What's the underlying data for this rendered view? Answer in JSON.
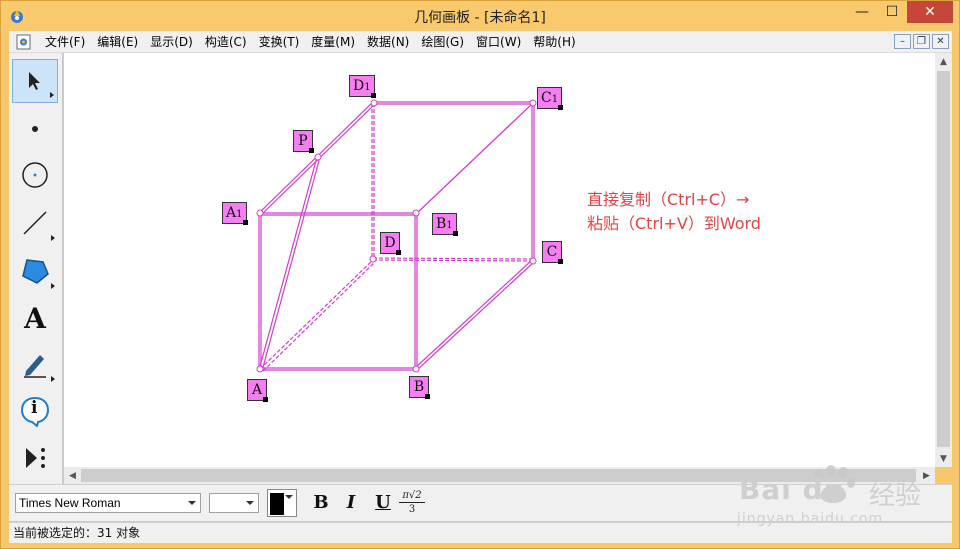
{
  "window": {
    "title": "几何画板 - [未命名1]",
    "minimize": "—",
    "maximize": "☐",
    "close": "✕"
  },
  "menu": {
    "items": [
      "文件(F)",
      "编辑(E)",
      "显示(D)",
      "构造(C)",
      "变换(T)",
      "度量(M)",
      "数据(N)",
      "绘图(G)",
      "窗口(W)",
      "帮助(H)"
    ],
    "mdi_minimize": "–",
    "mdi_restore": "❐",
    "mdi_close": "✕"
  },
  "toolbox": {
    "tools": [
      "select-arrow-tool",
      "point-tool",
      "compass-tool",
      "segment-tool",
      "polygon-tool",
      "text-tool",
      "marker-tool",
      "information-tool",
      "custom-tool"
    ],
    "text_tool_glyph": "A",
    "info_tool_glyph": "i"
  },
  "canvas": {
    "points": {
      "A": {
        "base": "A",
        "sub": ""
      },
      "B": {
        "base": "B",
        "sub": ""
      },
      "C": {
        "base": "C",
        "sub": ""
      },
      "D": {
        "base": "D",
        "sub": ""
      },
      "A1": {
        "base": "A",
        "sub": "1"
      },
      "B1": {
        "base": "B",
        "sub": "1"
      },
      "C1": {
        "base": "C",
        "sub": "1"
      },
      "D1": {
        "base": "D",
        "sub": "1"
      },
      "P": {
        "base": "P",
        "sub": ""
      }
    },
    "annotation_line1": "直接复制（Ctrl+C）→",
    "annotation_line2": "粘贴（Ctrl+V）到Word",
    "colors": {
      "figure": "#d63ad0",
      "label_bg": "#f57ef2",
      "annotation": "#e04545"
    }
  },
  "textbar": {
    "font": "Times New Roman",
    "size": "",
    "bold": "B",
    "italic": "I",
    "underline": "U",
    "math_top": "π√2",
    "math_bottom": "3"
  },
  "status": {
    "text": "当前被选定的：31 对象"
  },
  "watermark": {
    "brand": "Bai du",
    "product": "经验",
    "url": "jingyan.baidu.com"
  }
}
